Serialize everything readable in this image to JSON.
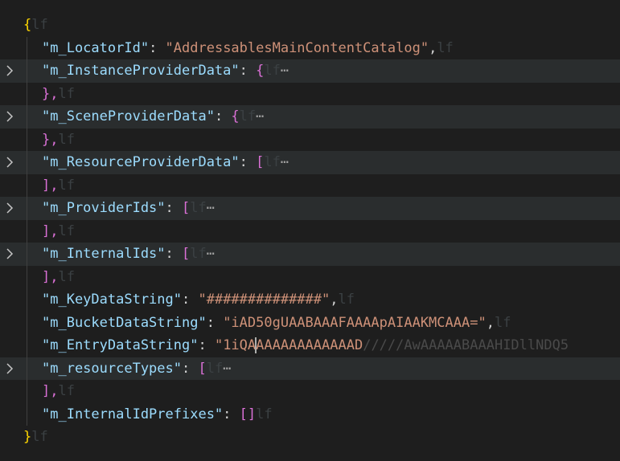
{
  "editor": {
    "eol_marker": "lf",
    "fold_ellipsis": "⋯",
    "lines": [
      {
        "open": "{"
      },
      {
        "key": "\"m_LocatorId\"",
        "sep": ": ",
        "value": "\"AddressablesMainContentCatalog\"",
        "trail": ","
      },
      {
        "key": "\"m_InstanceProviderData\"",
        "sep": ": ",
        "open": "{"
      },
      {
        "close": "},"
      },
      {
        "key": "\"m_SceneProviderData\"",
        "sep": ": ",
        "open": "{"
      },
      {
        "close": "},"
      },
      {
        "key": "\"m_ResourceProviderData\"",
        "sep": ": ",
        "open": "["
      },
      {
        "close": "],"
      },
      {
        "key": "\"m_ProviderIds\"",
        "sep": ": ",
        "open": "["
      },
      {
        "close": "],"
      },
      {
        "key": "\"m_InternalIds\"",
        "sep": ": ",
        "open": "["
      },
      {
        "close": "],"
      },
      {
        "key": "\"m_KeyDataString\"",
        "sep": ": ",
        "value": "\"##############\"",
        "trail": ","
      },
      {
        "key": "\"m_BucketDataString\"",
        "sep": ": ",
        "value": "\"iAD50gUAABAAAFAAAApAIAAKMCAAA=\"",
        "trail": ","
      },
      {
        "key": "\"m_EntryDataString\"",
        "sep": ": ",
        "value_a": "\"1iQA",
        "value_b": "AAAAAAAAAAAAD",
        "value_c": "/////AwAAAAABAAAHIDllNDQ5"
      },
      {
        "key": "\"m_resourceTypes\"",
        "sep": ": ",
        "open": "["
      },
      {
        "close": "],"
      },
      {
        "key": "\"m_InternalIdPrefixes\"",
        "sep": ": ",
        "value": "[]"
      },
      {
        "close": "}"
      }
    ]
  }
}
